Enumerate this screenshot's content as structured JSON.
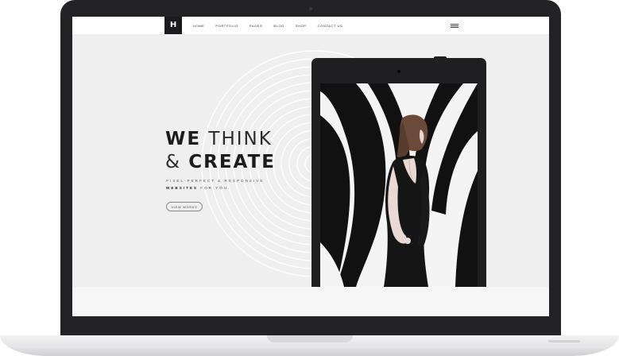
{
  "site": {
    "logo": "H",
    "nav": [
      "HOME",
      "PORTFOLIO",
      "PAGES",
      "BLOG",
      "SHOP",
      "CONTACT US"
    ]
  },
  "hero": {
    "line1_bold": "WE",
    "line1_light": "THINK",
    "line2_light": "&",
    "line2_bold": "CREATE",
    "tagline1": "PIXEL-PERFECT & RESPONSIVE",
    "tagline2_bold": "WEBSITES",
    "tagline2_rest": "FOR YOU.",
    "button": "VIEW WORKS"
  },
  "colors": {
    "laptop_frame": "#232325",
    "hero_bg": "#efeff0",
    "text_dark": "#1c1c1c"
  }
}
